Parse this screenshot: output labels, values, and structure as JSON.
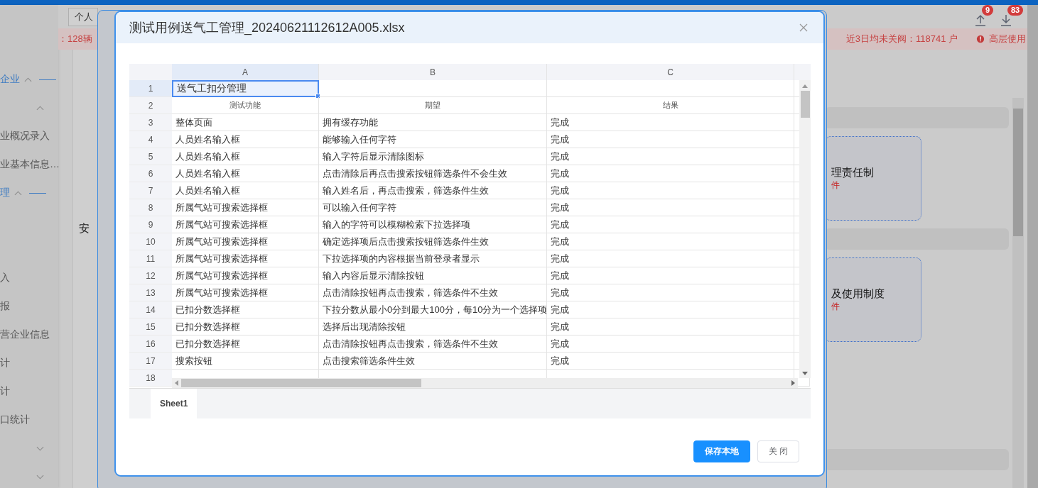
{
  "background": {
    "tab": "个人",
    "upload_badge": "9",
    "download_badge": "83",
    "alert_left": "：128辆",
    "alert_right": "近3日均未关阀：118741 户",
    "alert_warning": "高层使用",
    "sidebar": [
      {
        "kind": "group",
        "label": "企业",
        "expanded": true
      },
      {
        "kind": "toggle",
        "expanded": true
      },
      {
        "kind": "item",
        "label": "业概况录入"
      },
      {
        "kind": "item",
        "label": "业基本信息…"
      },
      {
        "kind": "group",
        "label": "理",
        "expanded": true
      },
      {
        "kind": "blank"
      },
      {
        "kind": "blank"
      },
      {
        "kind": "item",
        "label": "入"
      },
      {
        "kind": "item",
        "label": "报"
      },
      {
        "kind": "item",
        "label": "营企业信息"
      },
      {
        "kind": "item",
        "label": "计"
      },
      {
        "kind": "item",
        "label": "计"
      },
      {
        "kind": "item",
        "label": "口统计"
      },
      {
        "kind": "toggle",
        "expanded": false
      },
      {
        "kind": "toggle",
        "expanded": false
      }
    ],
    "panel_text": "安",
    "cards": [
      {
        "title": "理责任制",
        "note": "件"
      },
      {
        "title": "及使用制度",
        "note": "件"
      }
    ]
  },
  "dialog": {
    "title": "测试用例送气工管理_20240621112612A005.xlsx",
    "columns": [
      {
        "label": "A",
        "selected": true
      },
      {
        "label": "B",
        "selected": false
      },
      {
        "label": "C",
        "selected": false
      }
    ],
    "rows": [
      {
        "number": "1",
        "selected": true,
        "kind": "title",
        "cells": [
          "送气工扣分管理"
        ]
      },
      {
        "number": "2",
        "selected": false,
        "kind": "header",
        "cells": [
          "测试功能",
          "期望",
          "结果"
        ]
      },
      {
        "number": "3",
        "selected": false,
        "kind": "data",
        "cells": [
          "整体页面",
          "拥有缓存功能",
          "完成"
        ]
      },
      {
        "number": "4",
        "selected": false,
        "kind": "data",
        "cells": [
          "人员姓名输入框",
          "能够输入任何字符",
          "完成"
        ]
      },
      {
        "number": "5",
        "selected": false,
        "kind": "data",
        "cells": [
          "人员姓名输入框",
          "输入字符后显示清除图标",
          "完成"
        ]
      },
      {
        "number": "6",
        "selected": false,
        "kind": "data",
        "cells": [
          "人员姓名输入框",
          "点击清除后再点击搜索按钮筛选条件不会生效",
          "完成"
        ]
      },
      {
        "number": "7",
        "selected": false,
        "kind": "data",
        "cells": [
          "人员姓名输入框",
          "输入姓名后，再点击搜索，筛选条件生效",
          "完成"
        ]
      },
      {
        "number": "8",
        "selected": false,
        "kind": "data",
        "cells": [
          "所属气站可搜索选择框",
          "可以输入任何字符",
          "完成"
        ]
      },
      {
        "number": "9",
        "selected": false,
        "kind": "data",
        "cells": [
          "所属气站可搜索选择框",
          "输入的字符可以模糊检索下拉选择项",
          "完成"
        ]
      },
      {
        "number": "10",
        "selected": false,
        "kind": "data",
        "cells": [
          "所属气站可搜索选择框",
          "确定选择项后点击搜索按钮筛选条件生效",
          "完成"
        ]
      },
      {
        "number": "11",
        "selected": false,
        "kind": "data",
        "cells": [
          "所属气站可搜索选择框",
          "下拉选择项的内容根据当前登录者显示",
          "完成"
        ]
      },
      {
        "number": "12",
        "selected": false,
        "kind": "data",
        "cells": [
          "所属气站可搜索选择框",
          "输入内容后显示清除按钮",
          "完成"
        ]
      },
      {
        "number": "13",
        "selected": false,
        "kind": "data",
        "cells": [
          "所属气站可搜索选择框",
          "点击清除按钮再点击搜索，筛选条件不生效",
          "完成"
        ]
      },
      {
        "number": "14",
        "selected": false,
        "kind": "data",
        "cells": [
          "已扣分数选择框",
          "下拉分数从最小0分到最大100分，每10分为一个选择项",
          "完成"
        ]
      },
      {
        "number": "15",
        "selected": false,
        "kind": "data",
        "cells": [
          "已扣分数选择框",
          "选择后出现清除按钮",
          "完成"
        ]
      },
      {
        "number": "16",
        "selected": false,
        "kind": "data",
        "cells": [
          "已扣分数选择框",
          "点击清除按钮再点击搜索，筛选条件不生效",
          "完成"
        ]
      },
      {
        "number": "17",
        "selected": false,
        "kind": "data",
        "cells": [
          "搜索按钮",
          "点击搜索筛选条件生效",
          "完成"
        ]
      },
      {
        "number": "18",
        "selected": false,
        "kind": "data",
        "cells": []
      }
    ],
    "sheets": [
      {
        "label": "Sheet1",
        "selected": true
      }
    ],
    "buttons": [
      {
        "label": "保存本地",
        "kind": "primary"
      },
      {
        "label": "关 闭",
        "kind": "default"
      }
    ]
  }
}
